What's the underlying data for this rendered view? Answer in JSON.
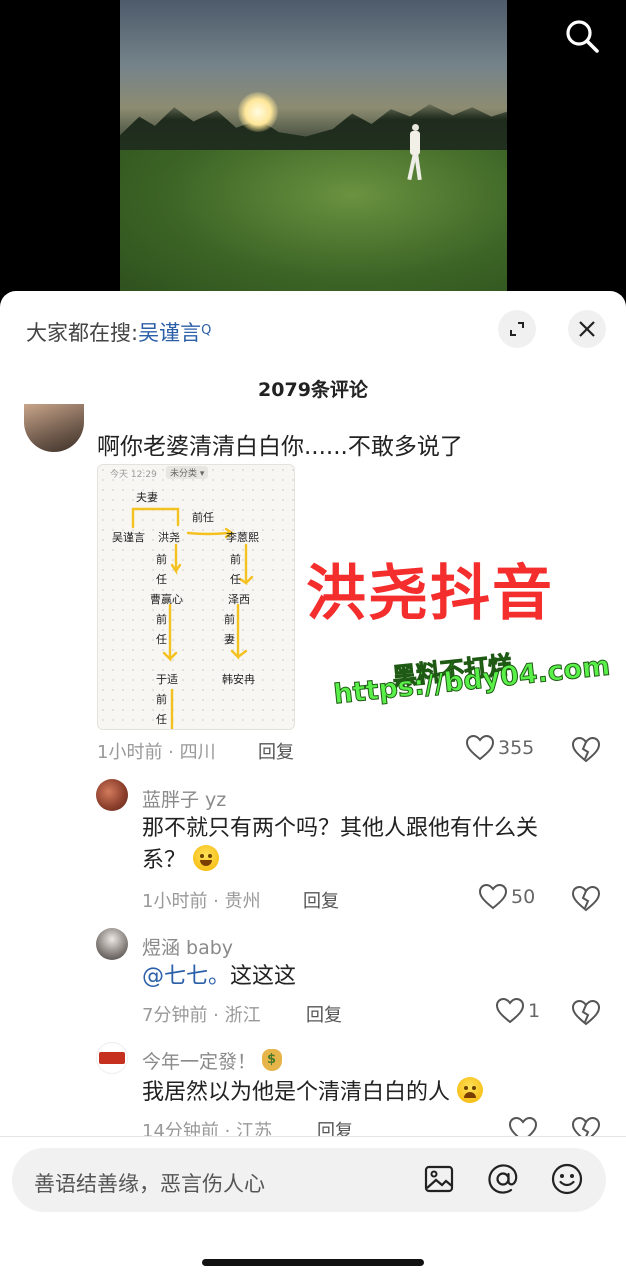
{
  "video": {
    "search_icon": "search-icon"
  },
  "panel": {
    "hot_search_prefix": "大家都在搜:",
    "hot_search_keyword": "吴谨言",
    "hot_search_suffix": "Q",
    "expand_icon": "expand-icon",
    "close_icon": "close-icon",
    "comment_count_title": "2079条评论"
  },
  "comments": [
    {
      "text": "啊你老婆清清白白你......不敢多说了",
      "meta": "1小时前 · 四川",
      "reply": "回复",
      "likes": "355",
      "image": {
        "header_time": "今天 12:29",
        "header_chip": "未分类 ▾",
        "labels": {
          "couple": "夫妻",
          "ex1": "前任",
          "wu": "吴谨言",
          "hong": "洪尧",
          "li": "李蒽熙",
          "qian1": "前",
          "ren1": "任",
          "qian2": "前",
          "ren2": "任",
          "cao": "曹赢心",
          "zexi": "泽西",
          "qian3": "前",
          "ren3": "任",
          "qian4": "前",
          "qi": "妻",
          "yu": "于适",
          "han": "韩安冉",
          "qian5": "前",
          "ren5": "任"
        }
      }
    },
    {
      "user": "蓝胖子 yz",
      "text_line1": "那不就只有两个吗？其他人跟他有什么关",
      "text_line2": "系？",
      "meta": "1小时前 · 贵州",
      "reply": "回复",
      "likes": "50"
    },
    {
      "user": "煜涵 baby",
      "mention": "@七七。",
      "text": "这这这",
      "meta": "7分钟前 · 浙江",
      "reply": "回复",
      "likes": "1"
    },
    {
      "user": "今年一定發！",
      "text": "我居然以为他是个清清白白的人",
      "meta": "14分钟前 · 江苏",
      "reply": "回复"
    }
  ],
  "watermarks": {
    "red": "洪尧抖音",
    "green_line1": "黑料不打烊",
    "green_line2": "https://bdy04.com"
  },
  "input": {
    "placeholder": "善语结善缘，恶言伤人心",
    "image_icon": "image-icon",
    "at_icon": "at-icon",
    "emoji_icon": "emoji-icon"
  }
}
